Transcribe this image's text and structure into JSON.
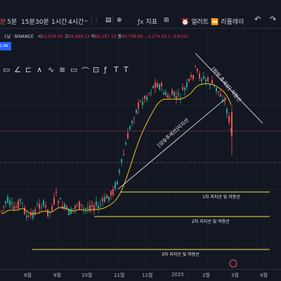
{
  "toolbar": {
    "timeframes": [
      "5분",
      "15분",
      "30분",
      "1시간",
      "4시간"
    ],
    "indicators_label": "지표",
    "alert_label": "얼러트",
    "replay_label": "리플레이"
  },
  "legend": {
    "symbol_line": "· 1날 · BINANCE",
    "open_label": "시",
    "open": "63,074.00",
    "high_label": "고",
    "high": "63,469.13",
    "low_label": "저",
    "low": "60,187.12",
    "close_label": "종",
    "close": "60,799.99",
    "change": "−2,274.02 (−3.61%)",
    "price_badge": "1.99"
  },
  "drawing_tools": [
    "▭",
    "∠",
    "⊏",
    "∧",
    "∿",
    "≋",
    "▭",
    "⌒",
    "⊡",
    "ƒ",
    "T",
    "T"
  ],
  "annotations": {
    "support1": "1차 지지선 및 저항선",
    "support2": "2차 지지선 및 저항선",
    "support3": "3차 지지선 및 저항선",
    "uptrend": "[상승추세선]지지선",
    "downtrend": "[하락 추세선] 저항선"
  },
  "colors": {
    "up": "#26a69a",
    "down": "#ef5350",
    "ma": "#f0c419",
    "support": "#f3e84a",
    "trendline": "#ffffff",
    "background": "#131722"
  },
  "chart_data": {
    "type": "candlestick",
    "x_ticks": [
      "8월",
      "9월",
      "10월",
      "11월",
      "12월",
      "2025",
      "2월",
      "3월",
      "4월"
    ],
    "price_range_approx": [
      48000,
      110000
    ],
    "ohlc_latest": {
      "open": 63074.0,
      "high": 63469.13,
      "low": 60187.12,
      "close": 60799.99
    },
    "segments": [
      {
        "from": "8월",
        "to": "10월",
        "behavior": "range"
      },
      {
        "from": "10월",
        "to": "12월",
        "behavior": "rally"
      },
      {
        "from": "12월",
        "to": "2월",
        "behavior": "high range"
      },
      {
        "from": "2월",
        "to": "3월",
        "behavior": "decline"
      }
    ]
  }
}
